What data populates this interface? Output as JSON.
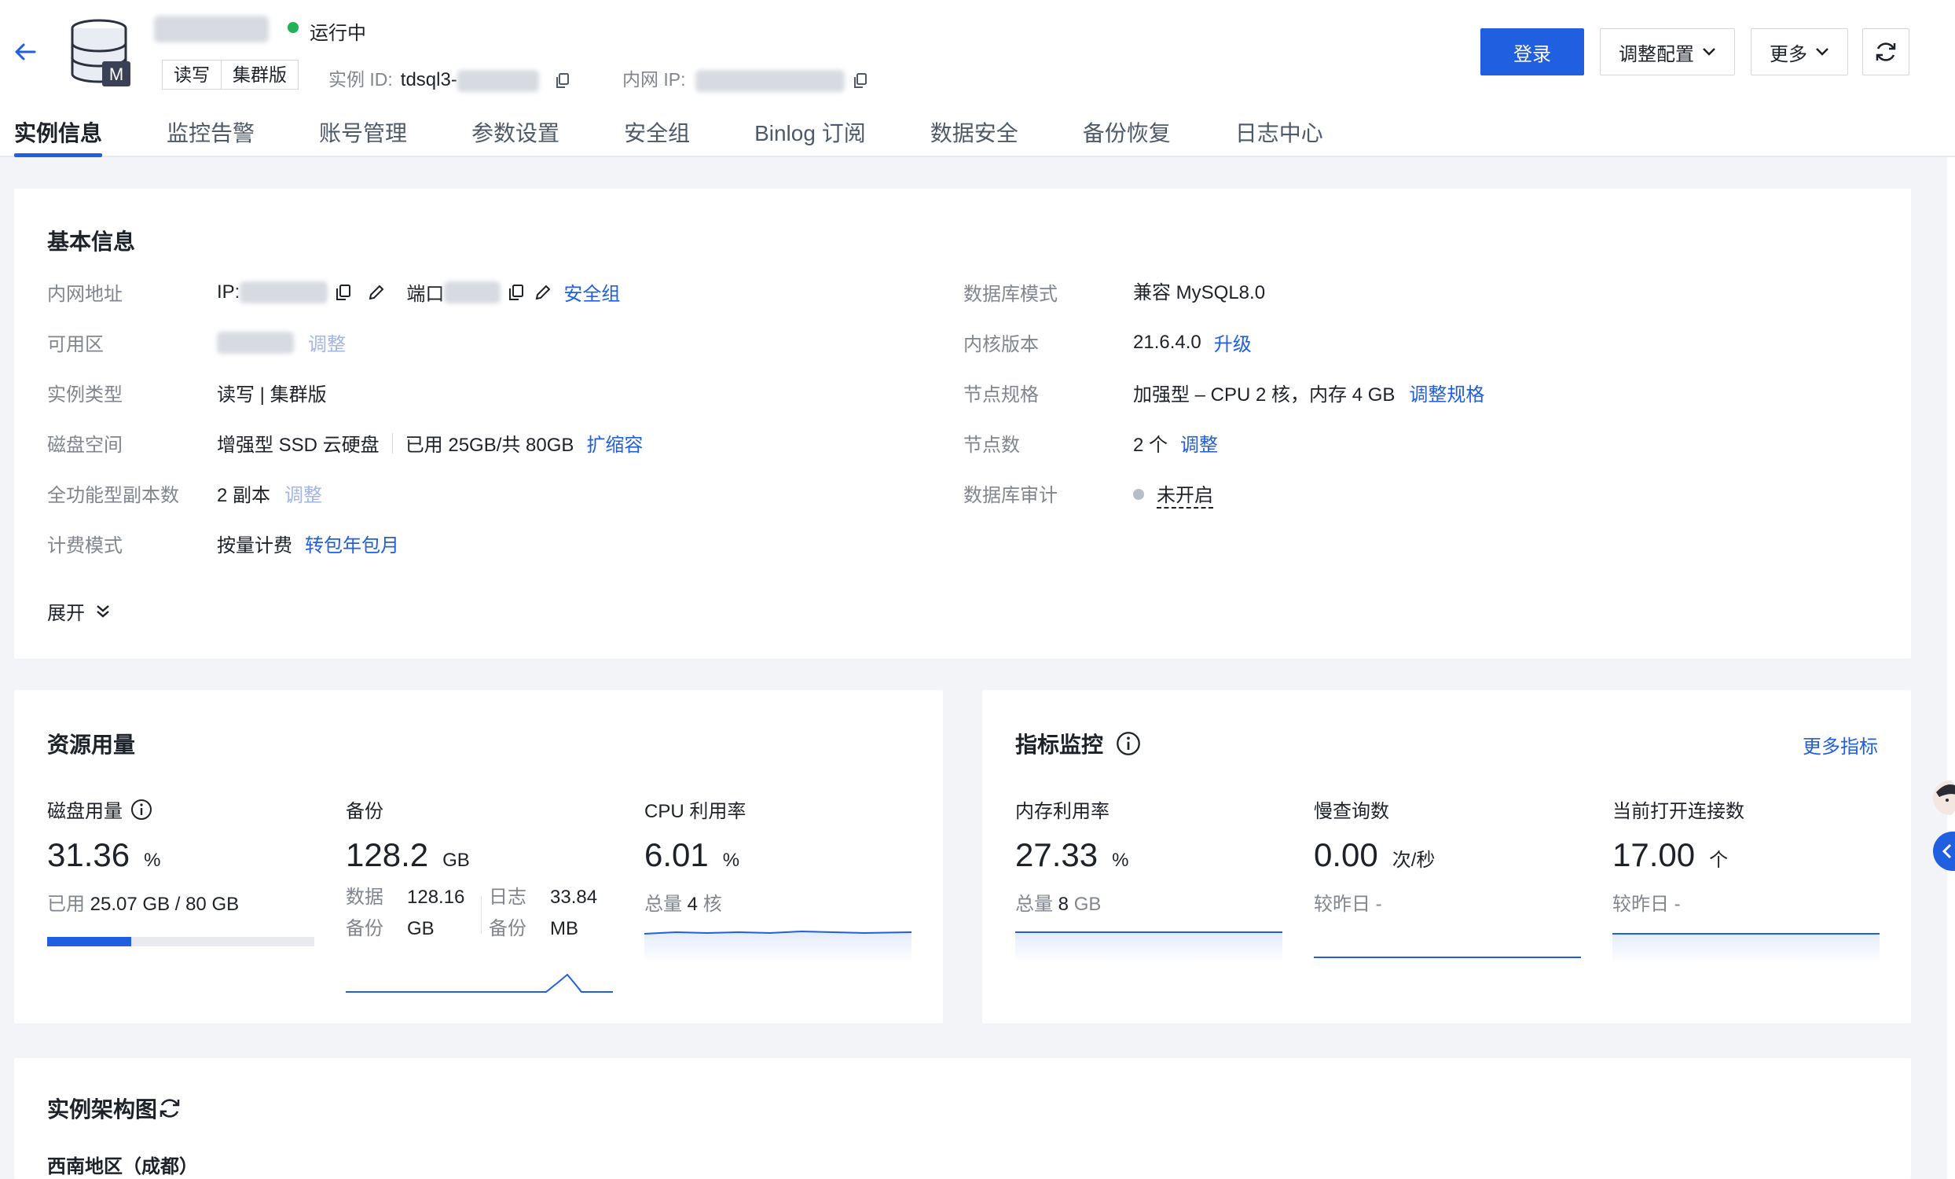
{
  "header": {
    "status": "运行中",
    "tags": [
      "读写",
      "集群版"
    ],
    "instance_id_label": "实例 ID:",
    "instance_id_prefix": "tdsql3-",
    "private_ip_label": "内网 IP:",
    "buttons": {
      "login": "登录",
      "adjust_config": "调整配置",
      "more": "更多"
    }
  },
  "tabs": [
    {
      "label": "实例信息"
    },
    {
      "label": "监控告警"
    },
    {
      "label": "账号管理"
    },
    {
      "label": "参数设置"
    },
    {
      "label": "安全组"
    },
    {
      "label": "Binlog 订阅"
    },
    {
      "label": "数据安全"
    },
    {
      "label": "备份恢复"
    },
    {
      "label": "日志中心"
    }
  ],
  "basic_info": {
    "title": "基本信息",
    "left": {
      "private_address_label": "内网地址",
      "ip_prefix": "IP:",
      "port_label": "端口",
      "security_group_link": "安全组",
      "zone_label": "可用区",
      "zone_adjust": "调整",
      "instance_type_label": "实例类型",
      "instance_type_value": "读写 | 集群版",
      "disk_label": "磁盘空间",
      "disk_type": "增强型 SSD 云硬盘",
      "disk_usage": "已用 25GB/共 80GB",
      "disk_expand": "扩缩容",
      "replica_label": "全功能型副本数",
      "replica_value": "2 副本",
      "replica_adjust": "调整",
      "billing_label": "计费模式",
      "billing_value": "按量计费",
      "billing_link": "转包年包月"
    },
    "right": {
      "db_mode_label": "数据库模式",
      "db_mode_value": "兼容 MySQL8.0",
      "kernel_label": "内核版本",
      "kernel_value": "21.6.4.0",
      "kernel_upgrade": "升级",
      "node_spec_label": "节点规格",
      "node_spec_value": "加强型 – CPU 2 核，内存 4 GB",
      "node_spec_adjust": "调整规格",
      "node_count_label": "节点数",
      "node_count_value": "2 个",
      "node_count_adjust": "调整",
      "audit_label": "数据库审计",
      "audit_value": "未开启"
    },
    "expand": "展开"
  },
  "resource_usage": {
    "title": "资源用量",
    "disk": {
      "label": "磁盘用量",
      "value": "31.36",
      "unit": "%",
      "sub_label": "已用",
      "sub_value": "25.07 GB / 80 GB",
      "progress": 0.3136
    },
    "backup": {
      "label": "备份",
      "value": "128.2",
      "unit": "GB",
      "data_label_1": "数据",
      "data_label_2": "备份",
      "data_value_1": "128.16",
      "data_value_2": "GB",
      "log_label_1": "日志",
      "log_label_2": "备份",
      "log_value_1": "33.84",
      "log_value_2": "MB"
    },
    "cpu": {
      "label": "CPU 利用率",
      "value": "6.01",
      "unit": "%",
      "sub_label": "总量",
      "sub_value": "4",
      "sub_unit": "核"
    }
  },
  "metrics": {
    "title": "指标监控",
    "more_link": "更多指标",
    "memory": {
      "label": "内存利用率",
      "value": "27.33",
      "unit": "%",
      "sub_label": "总量",
      "sub_value": "8",
      "sub_unit": "GB"
    },
    "slow_query": {
      "label": "慢查询数",
      "value": "0.00",
      "unit": "次/秒",
      "sub": "较昨日 -"
    },
    "connections": {
      "label": "当前打开连接数",
      "value": "17.00",
      "unit": "个",
      "sub": "较昨日 -"
    }
  },
  "architecture": {
    "title": "实例架构图",
    "region": "西南地区（成都）"
  },
  "colors": {
    "primary": "#1f5fe0",
    "running": "#1fb25b",
    "muted": "#808590"
  }
}
